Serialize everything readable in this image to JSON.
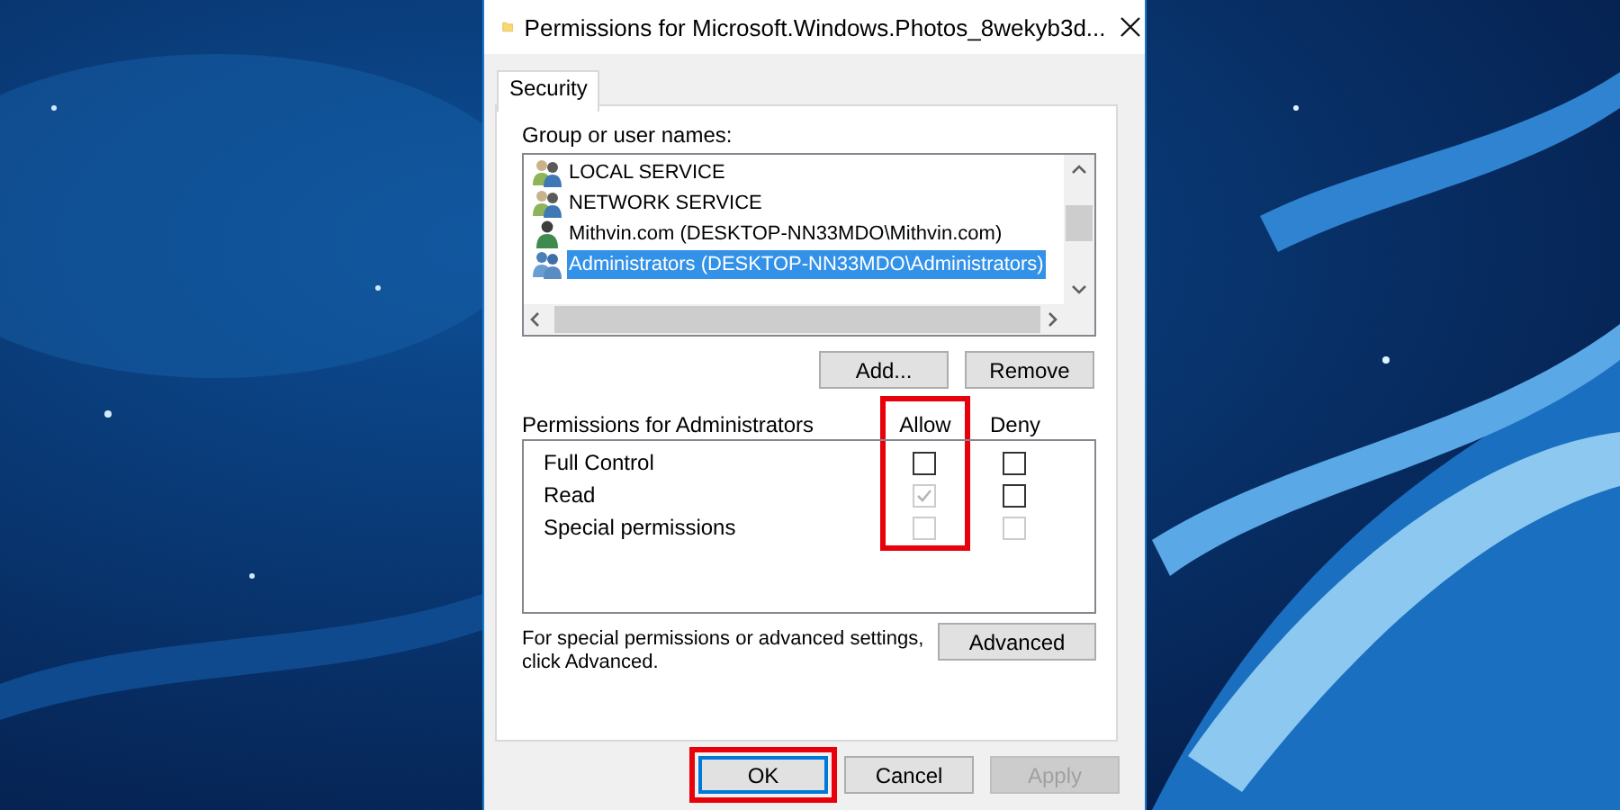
{
  "window": {
    "title": "Permissions for Microsoft.Windows.Photos_8wekyb3d..."
  },
  "tabs": [
    {
      "label": "Security",
      "selected": true
    }
  ],
  "group_list": {
    "label": "Group or user names:",
    "items": [
      {
        "name": "LOCAL SERVICE",
        "kind": "group",
        "selected": false
      },
      {
        "name": "NETWORK SERVICE",
        "kind": "group",
        "selected": false
      },
      {
        "name": "Mithvin.com (DESKTOP-NN33MDO\\Mithvin.com)",
        "kind": "user",
        "selected": false
      },
      {
        "name": "Administrators (DESKTOP-NN33MDO\\Administrators)",
        "kind": "admins",
        "selected": true
      }
    ]
  },
  "list_buttons": [
    "Add...",
    "Remove"
  ],
  "permissions": {
    "label": "Permissions for Administrators",
    "columns": [
      {
        "label": "Allow",
        "highlighted": true
      },
      {
        "label": "Deny",
        "highlighted": false
      }
    ],
    "rows": [
      {
        "name": "Full Control",
        "allow": {
          "checked": false,
          "disabled": false
        },
        "deny": {
          "checked": false,
          "disabled": false
        }
      },
      {
        "name": "Read",
        "allow": {
          "checked": true,
          "disabled": true
        },
        "deny": {
          "checked": false,
          "disabled": false
        }
      },
      {
        "name": "Special permissions",
        "allow": {
          "checked": false,
          "disabled": true
        },
        "deny": {
          "checked": false,
          "disabled": true
        }
      }
    ]
  },
  "advanced": {
    "text": "For special permissions or advanced settings, click Advanced.",
    "button": "Advanced"
  },
  "buttons": [
    {
      "label": "OK",
      "default": true,
      "highlighted": true,
      "disabled": false
    },
    {
      "label": "Cancel",
      "default": false,
      "highlighted": false,
      "disabled": false
    },
    {
      "label": "Apply",
      "default": false,
      "highlighted": false,
      "disabled": true
    }
  ]
}
